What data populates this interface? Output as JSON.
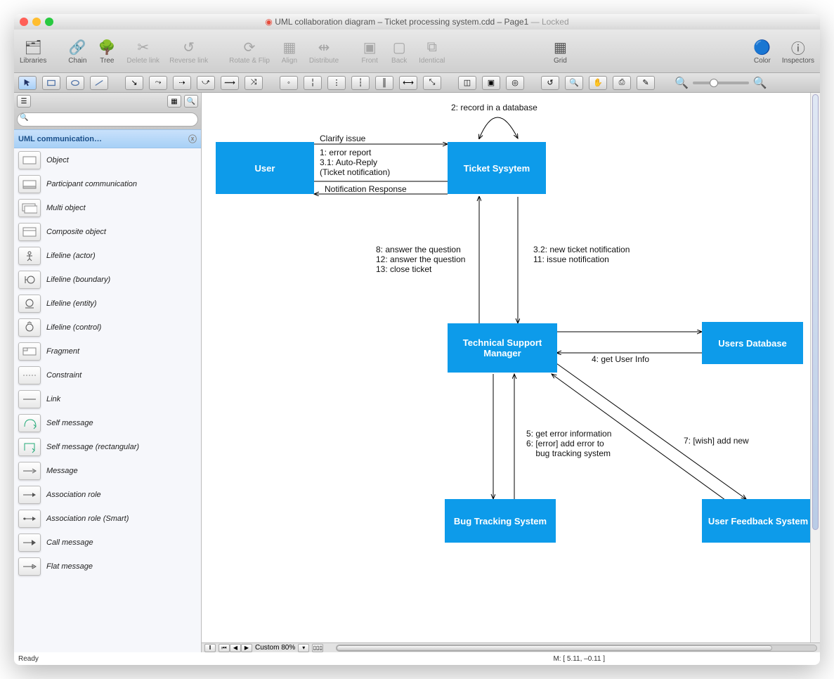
{
  "title": {
    "doc": "UML collaboration diagram – Ticket processing system.cdd – Page1",
    "suffix": " — Locked"
  },
  "toolbar": {
    "libraries": "Libraries",
    "chain": "Chain",
    "tree": "Tree",
    "delete_link": "Delete link",
    "reverse_link": "Reverse link",
    "rotate": "Rotate & Flip",
    "align": "Align",
    "distribute": "Distribute",
    "front": "Front",
    "back": "Back",
    "identical": "Identical",
    "grid": "Grid",
    "color": "Color",
    "inspectors": "Inspectors"
  },
  "sidebar": {
    "lib_title": "UML communication…",
    "search_placeholder": "",
    "items": [
      "Object",
      "Participant communication",
      "Multi object",
      "Composite object",
      "Lifeline (actor)",
      "Lifeline (boundary)",
      "Lifeline (entity)",
      "Lifeline (control)",
      "Fragment",
      "Constraint",
      "Link",
      "Self message",
      "Self message (rectangular)",
      "Message",
      "Association role",
      "Association role (Smart)",
      "Call message",
      "Flat message"
    ]
  },
  "diagram": {
    "nodes": {
      "user": "User",
      "ticket": "Ticket Sysytem",
      "tsm": "Technical Support\nManager",
      "db": "Users Database",
      "bug": "Bug Tracking System",
      "ufs": "User Feedback System"
    },
    "labels": {
      "clarify": "Clarify issue",
      "err_lines": "1: error report\n3.1: Auto-Reply\n(Ticket notification)",
      "notif": "Notification Response",
      "self": "2: record in a database",
      "left8": "8: answer the question\n12: answer the question\n13: close ticket",
      "right32": "3.2: new ticket notification\n11: issue notification",
      "getuser": "4: get User Info",
      "bug56": "5: get error information\n6: [error] add error to\n    bug tracking system",
      "wish": "7: [wish] add new"
    }
  },
  "bottom": {
    "zoom": "Custom 80%"
  },
  "status": {
    "ready": "Ready",
    "mouse": "M: [ 5.11, –0.11 ]"
  }
}
